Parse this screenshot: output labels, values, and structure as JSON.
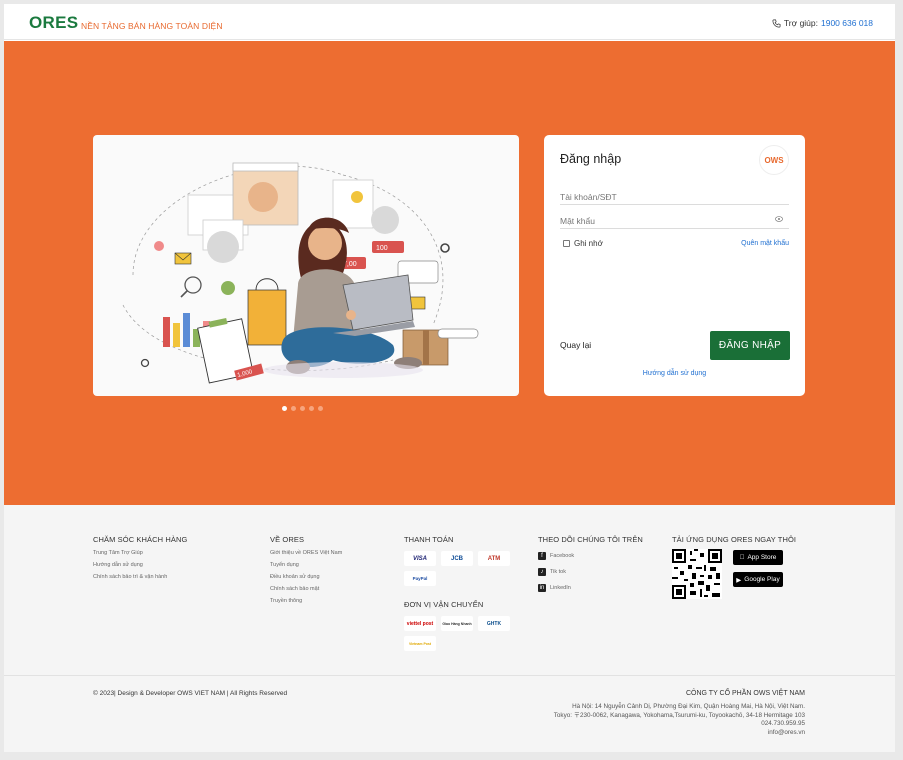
{
  "header": {
    "logo": "ORES",
    "slogan": "NỀN TẢNG BÁN HÀNG TOÀN DIỆN",
    "help_label": "Trợ giúp:",
    "help_phone": "1900 636 018"
  },
  "carousel": {
    "count": 5,
    "active_index": 0,
    "illustration_labels": [
      "1,000",
      "100",
      "7,00"
    ]
  },
  "login": {
    "title": "Đăng nhập",
    "brand_logo_text": "OWS",
    "username_placeholder": "Tài khoản/SĐT",
    "password_placeholder": "Mật khẩu",
    "remember_label": "Ghi nhớ",
    "forgot_label": "Quên mật khẩu",
    "back_label": "Quay lại",
    "submit_label": "ĐĂNG NHẬP",
    "guide_label": "Hướng dẫn sử dụng"
  },
  "footer": {
    "support": {
      "title": "CHĂM SÓC KHÁCH HÀNG",
      "links": [
        "Trung Tâm Trợ Giúp",
        "Hướng dẫn sử dụng",
        "Chính sách bảo trì & vận hành"
      ]
    },
    "about": {
      "title": "VỀ ORES",
      "links": [
        "Giới thiệu về ORES Việt Nam",
        "Tuyển dụng",
        "Điều khoản sử dụng",
        "Chính sách bảo mật",
        "Truyền thông"
      ]
    },
    "payment": {
      "title": "THANH TOÁN",
      "methods": [
        "VISA",
        "JCB",
        "ATM",
        "PayPal"
      ]
    },
    "shipping": {
      "title": "ĐƠN VỊ VẬN CHUYỂN",
      "carriers": [
        "viettel post",
        "Giao Hàng Nhanh",
        "GHTK",
        "Vietnam Post"
      ]
    },
    "social": {
      "title": "THEO DÕI CHÚNG TÔI TRÊN",
      "items": [
        "Facebook",
        "Tik tok",
        "LinkedIn"
      ]
    },
    "app": {
      "title": "TẢI ỨNG DỤNG ORES NGAY THÔI",
      "app_store": "App Store",
      "google_play": "Google Play"
    },
    "copyright": "© 2023| Design & Developer OWS VIET NAM | All Rights Reserved",
    "company": {
      "name": "CÔNG TY CỔ PHẦN OWS VIỆT NAM",
      "address_hn": "Hà Nội: 14 Nguyễn Cảnh Dị, Phường Đại Kim, Quận Hoàng Mai, Hà Nội, Việt Nam.",
      "address_tokyo": "Tokyo: 〒230-0062, Kanagawa, Yokohama,Tsurumi-ku, Toyookachō, 34-18 Hermitage 103",
      "phone": "024.730.959.95",
      "email": "info@ores.vn"
    }
  },
  "colors": {
    "brand_green": "#1a6f37",
    "hero_orange": "#ed6d31",
    "link_blue": "#1f6fd1"
  }
}
